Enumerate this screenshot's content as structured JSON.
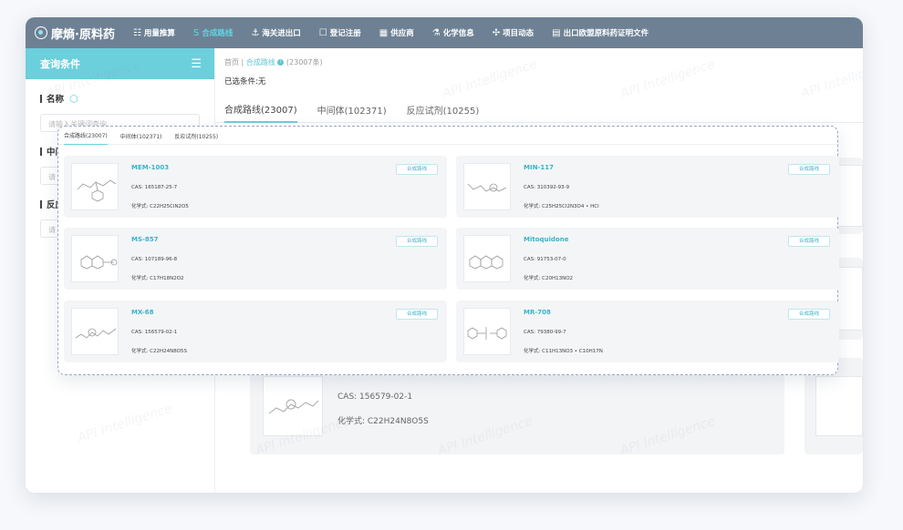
{
  "app": {
    "logo": "摩熵·原料药"
  },
  "nav": [
    {
      "icon": "☷",
      "label": "用量推算"
    },
    {
      "icon": "S",
      "label": "合成路线"
    },
    {
      "icon": "⚓",
      "label": "海关进出口"
    },
    {
      "icon": "☐",
      "label": "登记注册"
    },
    {
      "icon": "▦",
      "label": "供应商"
    },
    {
      "icon": "⚗",
      "label": "化学信息"
    },
    {
      "icon": "✣",
      "label": "项目动态"
    },
    {
      "icon": "▤",
      "label": "出口欧盟原料药证明文件"
    }
  ],
  "sidebar": {
    "title": "查询条件",
    "fields": [
      {
        "label": "名称",
        "placeholder": "请输入关键词查询"
      },
      {
        "label": "中间",
        "placeholder": "请"
      },
      {
        "label": "反应",
        "placeholder": "请"
      }
    ]
  },
  "breadcrumb": {
    "home": "首页",
    "sep": "|",
    "current": "合成路线",
    "count": "(23007条)"
  },
  "selected_conditions": "已选条件:无",
  "tabs": [
    "合成路线(23007)",
    "中间体(102371)",
    "反应试剂(10255)"
  ],
  "background_card": {
    "cas": "CAS: 156579-02-1",
    "formula": "化学式: C22H24N8O5S"
  },
  "popup": {
    "tabs": [
      "合成路线(23007)",
      "中间体(102371)",
      "反应试剂(10255)"
    ],
    "cards": [
      {
        "name": "MEM-1003",
        "cas": "CAS: 165187-25-7",
        "formula": "化学式: C22H25ClN2O5",
        "tag": "合成路线"
      },
      {
        "name": "MIN-117",
        "cas": "CAS: 310392-93-9",
        "formula": "化学式: C25H25Cl2N3O4 • HCl",
        "tag": "合成路线"
      },
      {
        "name": "MS-857",
        "cas": "CAS: 107189-96-8",
        "formula": "化学式: C17H18N2O2",
        "tag": "合成路线"
      },
      {
        "name": "Mitoquidone",
        "cas": "CAS: 91753-07-0",
        "formula": "化学式: C20H13NO2",
        "tag": "合成路线"
      },
      {
        "name": "MX-68",
        "cas": "CAS: 156579-02-1",
        "formula": "化学式: C22H24N8O5S",
        "tag": "合成路线"
      },
      {
        "name": "MR-708",
        "cas": "CAS: 79380-99-7",
        "formula": "化学式: C11H13NO3 • C10H17N",
        "tag": "合成路线"
      }
    ]
  },
  "watermark": "API Intelligence"
}
